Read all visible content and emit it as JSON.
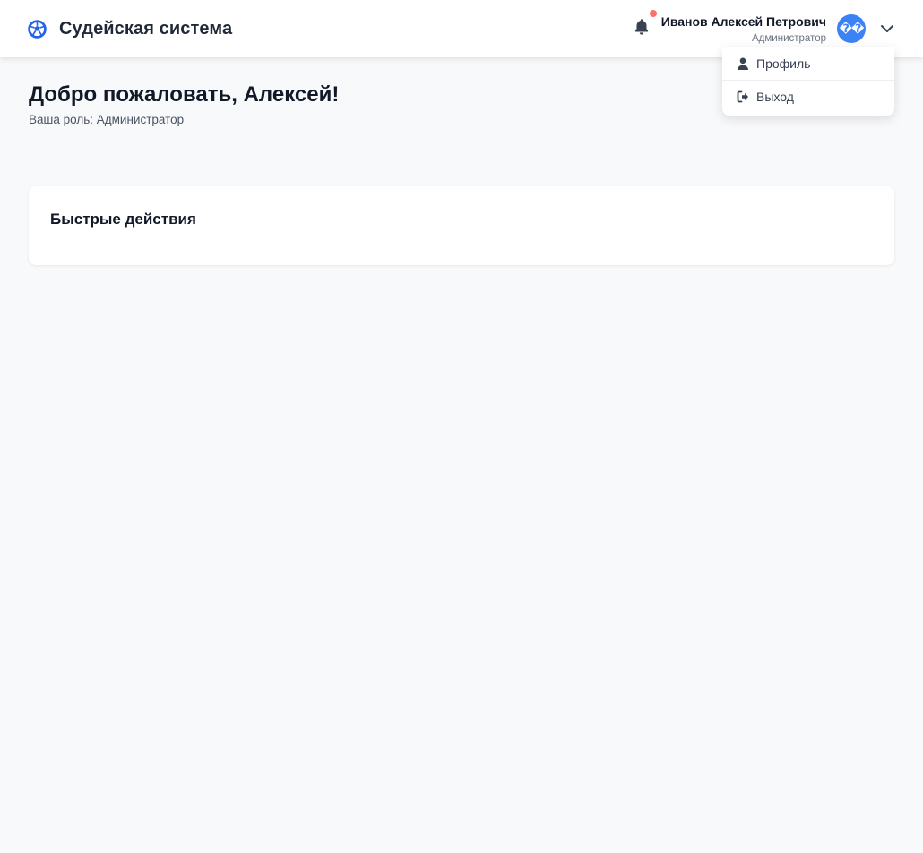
{
  "header": {
    "brand_icon": "football-icon",
    "title": "Судейская система",
    "notifications": {
      "icon": "bell-icon",
      "has_unread": true,
      "dot_color": "#f87171"
    },
    "user": {
      "name": "Иванов Алексей Петрович",
      "role": "Администратор",
      "avatar_text": "��",
      "avatar_color": "#3b82f6"
    },
    "menu_toggle_icon": "chevron-down-icon"
  },
  "user_menu": {
    "items": [
      {
        "label": "Профиль",
        "icon": "user-icon"
      },
      {
        "label": "Выход",
        "icon": "logout-icon"
      }
    ]
  },
  "main": {
    "welcome_title": "Добро пожаловать, Алексей!",
    "role_label": "Ваша роль:",
    "role_value": "Администратор",
    "quick_actions_title": "Быстрые действия"
  },
  "colors": {
    "accent": "#3b82f6",
    "background": "#f8f9fb",
    "text_primary": "#111827",
    "text_secondary": "#6b7280"
  }
}
